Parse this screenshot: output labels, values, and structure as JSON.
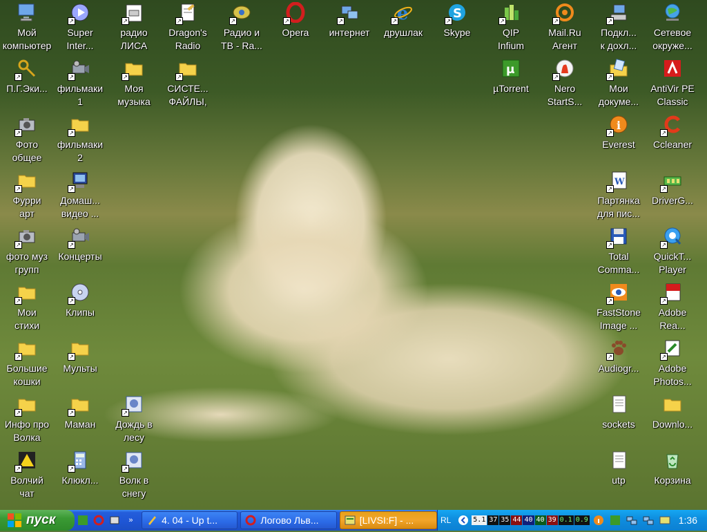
{
  "desktop": {
    "icons": [
      {
        "label": "Мой\nкомпьютер",
        "icon": "computer-icon"
      },
      {
        "label": "Super\nInter...",
        "icon": "media-player-icon"
      },
      {
        "label": "радио\nЛИСА",
        "icon": "radio-icon"
      },
      {
        "label": "Dragon's\nRadio",
        "icon": "notepad-icon"
      },
      {
        "label": "Радио и\nТВ - Ra...",
        "icon": "satellite-icon"
      },
      {
        "label": "Opera",
        "icon": "opera-icon"
      },
      {
        "label": "интернет",
        "icon": "network-icon"
      },
      {
        "label": "друшлак",
        "icon": "ie-icon"
      },
      {
        "label": "Skype",
        "icon": "skype-icon"
      },
      {
        "label": "QIP\nInfium",
        "icon": "qip-icon"
      },
      {
        "label": "Mail.Ru\nАгент",
        "icon": "mailru-icon"
      },
      {
        "label": "Подкл...\nк дохл...",
        "icon": "connection-icon"
      },
      {
        "label": "Сетевое\nокруже...",
        "icon": "globe-icon"
      },
      {
        "label": "П.Г.Эки...",
        "icon": "key-icon"
      },
      {
        "label": "фильмаки\n1",
        "icon": "camcorder-icon"
      },
      {
        "label": "Моя\nмузыка",
        "icon": "folder-icon"
      },
      {
        "label": "СИСТЕ...\nФАЙЛЫ,",
        "icon": "folder-icon"
      },
      {
        "label": "µTorrent",
        "icon": "utorrent-icon"
      },
      {
        "label": "Nero\nStartS...",
        "icon": "nero-icon"
      },
      {
        "label": "Мои\nдокуме...",
        "icon": "documents-icon"
      },
      {
        "label": "AntiVir PE\nClassic",
        "icon": "antivir-icon"
      },
      {
        "label": "Фото\nобщее",
        "icon": "camera-icon"
      },
      {
        "label": "фильмаки\n2",
        "icon": "folder-icon"
      },
      {
        "label": "Everest",
        "icon": "info-icon"
      },
      {
        "label": "Ccleaner",
        "icon": "ccleaner-icon"
      },
      {
        "label": "Фурри\nарт",
        "icon": "folder-icon"
      },
      {
        "label": "Домаш...\nвидео ...",
        "icon": "video-icon"
      },
      {
        "label": "Партянка\nдля пис...",
        "icon": "word-icon"
      },
      {
        "label": "DriverG...",
        "icon": "driver-icon"
      },
      {
        "label": "фото муз\nгрупп",
        "icon": "camera-icon"
      },
      {
        "label": "Концерты",
        "icon": "camcorder-icon"
      },
      {
        "label": "Total\nComma...",
        "icon": "floppy-icon"
      },
      {
        "label": "QuickT...\nPlayer",
        "icon": "quicktime-icon"
      },
      {
        "label": "Мои\nстихи",
        "icon": "folder-icon"
      },
      {
        "label": "Клипы",
        "icon": "cd-icon"
      },
      {
        "label": "FastStone\nImage ...",
        "icon": "eye-icon"
      },
      {
        "label": "Adobe\nRea...",
        "icon": "pdf-icon"
      },
      {
        "label": "Большие\nкошки",
        "icon": "folder-icon"
      },
      {
        "label": "Мульты",
        "icon": "folder-icon"
      },
      {
        "label": "Audiogr...",
        "icon": "paw-icon"
      },
      {
        "label": "Adobe\nPhotos...",
        "icon": "photoshop-icon"
      },
      {
        "label": "Инфо про\nВолка",
        "icon": "folder-icon"
      },
      {
        "label": "Маман",
        "icon": "folder-icon"
      },
      {
        "label": "Дождь в\nлесу",
        "icon": "image-icon"
      },
      {
        "label": "sockets",
        "icon": "text-file-icon"
      },
      {
        "label": "Downlo...",
        "icon": "folder-icon"
      },
      {
        "label": "Волчий\nчат",
        "icon": "yellow-arrow-icon"
      },
      {
        "label": "Клюкл...",
        "icon": "calculator-icon"
      },
      {
        "label": "Волк в\nснегу",
        "icon": "image-icon"
      },
      {
        "label": "utp",
        "icon": "text-file-icon"
      },
      {
        "label": "Корзина",
        "icon": "recycle-bin-icon"
      }
    ]
  },
  "taskbar": {
    "start_label": "пуск",
    "tasks": [
      {
        "label": "4. 04 - Up t...",
        "icon": "winamp-icon",
        "active": false
      },
      {
        "label": "Логово Льв...",
        "icon": "opera-icon",
        "active": false
      },
      {
        "label": "[LIVSI:F] - ...",
        "icon": "app-icon",
        "active": true
      }
    ],
    "lang": "RL",
    "meters": [
      "5.1",
      "37",
      "35",
      "44",
      "40",
      "40",
      "39",
      "0.1",
      "0.9"
    ],
    "clock": "1:36"
  },
  "colors": {
    "folder": "#f5d24a",
    "accent": "#245edb",
    "start": "#3a9a34",
    "task_active": "#f2a52a"
  }
}
